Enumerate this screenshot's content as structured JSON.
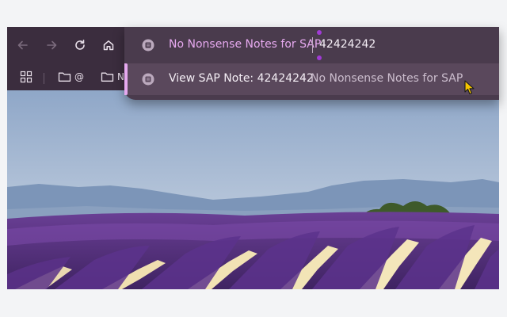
{
  "toolbar": {
    "back_icon": "arrow-left-icon",
    "forward_icon": "arrow-right-icon",
    "reload_icon": "reload-icon",
    "home_icon": "home-icon"
  },
  "bookmarks": {
    "apps_icon": "apps-grid-icon",
    "items": [
      {
        "icon": "folder-icon",
        "label": "@"
      },
      {
        "icon": "folder-icon",
        "label": "N"
      }
    ]
  },
  "omnibox": {
    "keyword_label": "No Nonsense Notes for SAP",
    "query": "42424242",
    "suggestion": {
      "title": "View SAP Note: 42424242",
      "separator": "-",
      "subtitle": "No Nonsense Notes for SAP"
    }
  },
  "colors": {
    "frame": "#3b2d3e",
    "omnibox": "#4a3b4d",
    "selected_row": "#5a485c",
    "accent": "#e6a9ef",
    "caret": "#a13bd6"
  }
}
